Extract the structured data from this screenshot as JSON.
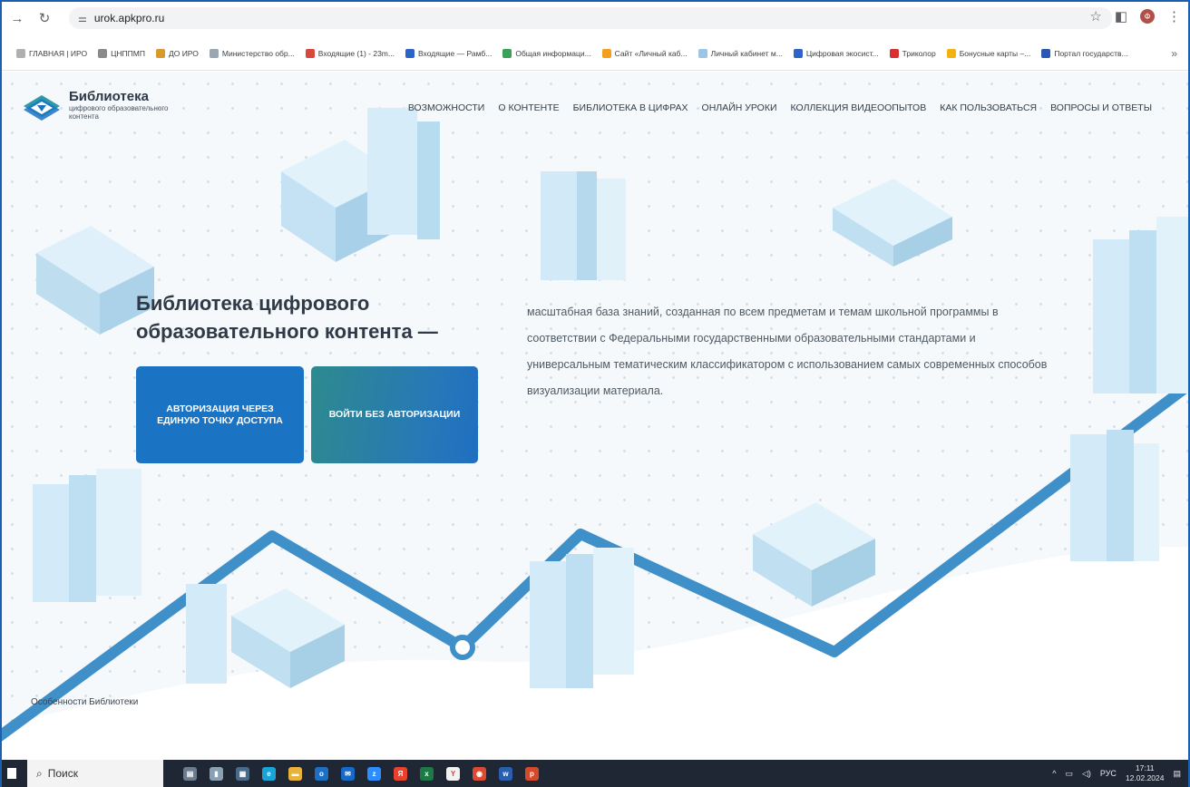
{
  "browser": {
    "url": "urok.apkpro.ru",
    "bookmarks": [
      {
        "label": "ГЛАВНАЯ | ИРО",
        "color": "#b0b0b0"
      },
      {
        "label": "ЦНППМП",
        "color": "#8a8a8a"
      },
      {
        "label": "ДО ИРО",
        "color": "#d89a2b"
      },
      {
        "label": "Министерство обр...",
        "color": "#9aa7b3"
      },
      {
        "label": "Входящие (1) - 23m...",
        "color": "#d9473d"
      },
      {
        "label": "Входящие — Рамб...",
        "color": "#2c63c8"
      },
      {
        "label": "Общая информаци...",
        "color": "#3aa05a"
      },
      {
        "label": "Сайт «Личный каб...",
        "color": "#f2a01e"
      },
      {
        "label": "Личный кабинет м...",
        "color": "#9cc4e4"
      },
      {
        "label": "Цифровая экосист...",
        "color": "#2f63c6"
      },
      {
        "label": "Триколор",
        "color": "#d73030"
      },
      {
        "label": "Бонусные карты –...",
        "color": "#f2b311"
      },
      {
        "label": "Портал государств...",
        "color": "#2b56b3"
      }
    ],
    "more_label": "»"
  },
  "site": {
    "logo_title": "Библиотека",
    "logo_subtitle": "цифрового образовательного контента",
    "nav": [
      "ВОЗМОЖНОСТИ",
      "О КОНТЕНТЕ",
      "БИБЛИОТЕКА В ЦИФРАХ",
      "ОНЛАЙН УРОКИ",
      "КОЛЛЕКЦИЯ ВИДЕООПЫТОВ",
      "КАК ПОЛЬЗОВАТЬСЯ",
      "ВОПРОСЫ И ОТВЕТЫ"
    ],
    "hero_title": "Библиотека цифрового образовательного контента —",
    "hero_description": "масштабная база знаний, созданная по всем предметам и темам школьной программы в соответствии с Федеральными государственными образовательными стандартами и универсальным тематическим классификатором с использованием самых современных способов визуализации материала.",
    "button_auth": "АВТОРИЗАЦИЯ ЧЕРЕЗ ЕДИНУЮ ТОЧКУ ДОСТУПА",
    "button_guest": "ВОЙТИ БЕЗ АВТОРИЗАЦИИ",
    "features_link": "Особенности Библиотеки"
  },
  "taskbar": {
    "search_placeholder": "Поиск",
    "language": "РУС",
    "time": "17:11",
    "date": "12.02.2024"
  },
  "colors": {
    "primary_button": "#1b73c3",
    "path_line": "#3f8fc9",
    "accent_border": "#1b5fb0"
  }
}
